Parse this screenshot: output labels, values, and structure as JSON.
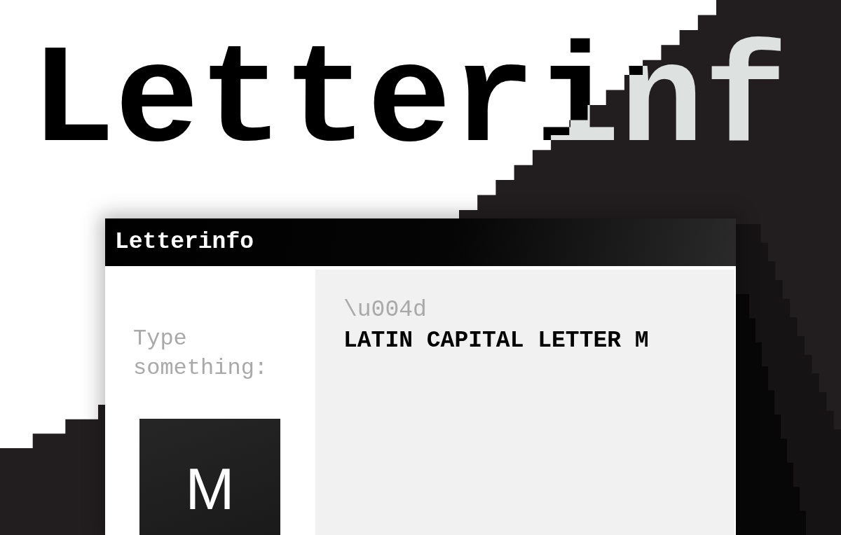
{
  "hero_title": "Letterinf",
  "window": {
    "title": "Letterinfo"
  },
  "input": {
    "label": "Type something:",
    "value": "M"
  },
  "result": {
    "code": "\\u004d",
    "name": "LATIN CAPITAL LETTER M"
  }
}
